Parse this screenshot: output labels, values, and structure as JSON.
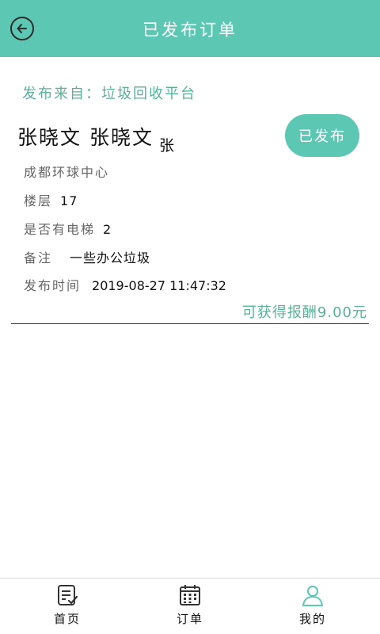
{
  "header": {
    "title": "已发布订单",
    "back_icon": "arrow-left-circle-icon"
  },
  "order": {
    "source": "发布来自：垃圾回收平台",
    "name_main": "张晓文 张晓文",
    "name_sub": "张",
    "status_label": "已发布",
    "address": "成都环球中心",
    "fields": [
      {
        "label": "楼层",
        "value": "17"
      },
      {
        "label": "是否有电梯",
        "value": "2"
      },
      {
        "label": "备注",
        "value": "一些办公垃圾"
      },
      {
        "label": "发布时间",
        "value": "2019-08-27 11:47:32"
      }
    ],
    "reward": "可获得报酬9.00元"
  },
  "nav": {
    "items": [
      {
        "label": "首页",
        "icon": "document-check-icon"
      },
      {
        "label": "订单",
        "icon": "calendar-icon"
      },
      {
        "label": "我的",
        "icon": "user-icon"
      }
    ]
  },
  "colors": {
    "accent": "#5cc8b4",
    "accent_text": "#56b39a"
  }
}
